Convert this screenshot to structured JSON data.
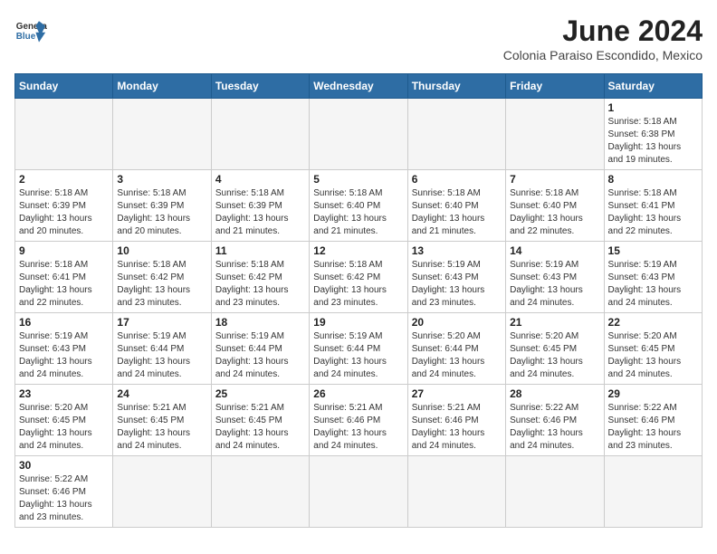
{
  "header": {
    "logo_general": "General",
    "logo_blue": "Blue",
    "month_title": "June 2024",
    "subtitle": "Colonia Paraiso Escondido, Mexico"
  },
  "weekdays": [
    "Sunday",
    "Monday",
    "Tuesday",
    "Wednesday",
    "Thursday",
    "Friday",
    "Saturday"
  ],
  "days": {
    "d1": {
      "num": "1",
      "sunrise": "Sunrise: 5:18 AM",
      "sunset": "Sunset: 6:38 PM",
      "daylight": "Daylight: 13 hours and 19 minutes."
    },
    "d2": {
      "num": "2",
      "sunrise": "Sunrise: 5:18 AM",
      "sunset": "Sunset: 6:39 PM",
      "daylight": "Daylight: 13 hours and 20 minutes."
    },
    "d3": {
      "num": "3",
      "sunrise": "Sunrise: 5:18 AM",
      "sunset": "Sunset: 6:39 PM",
      "daylight": "Daylight: 13 hours and 20 minutes."
    },
    "d4": {
      "num": "4",
      "sunrise": "Sunrise: 5:18 AM",
      "sunset": "Sunset: 6:39 PM",
      "daylight": "Daylight: 13 hours and 21 minutes."
    },
    "d5": {
      "num": "5",
      "sunrise": "Sunrise: 5:18 AM",
      "sunset": "Sunset: 6:40 PM",
      "daylight": "Daylight: 13 hours and 21 minutes."
    },
    "d6": {
      "num": "6",
      "sunrise": "Sunrise: 5:18 AM",
      "sunset": "Sunset: 6:40 PM",
      "daylight": "Daylight: 13 hours and 21 minutes."
    },
    "d7": {
      "num": "7",
      "sunrise": "Sunrise: 5:18 AM",
      "sunset": "Sunset: 6:40 PM",
      "daylight": "Daylight: 13 hours and 22 minutes."
    },
    "d8": {
      "num": "8",
      "sunrise": "Sunrise: 5:18 AM",
      "sunset": "Sunset: 6:41 PM",
      "daylight": "Daylight: 13 hours and 22 minutes."
    },
    "d9": {
      "num": "9",
      "sunrise": "Sunrise: 5:18 AM",
      "sunset": "Sunset: 6:41 PM",
      "daylight": "Daylight: 13 hours and 22 minutes."
    },
    "d10": {
      "num": "10",
      "sunrise": "Sunrise: 5:18 AM",
      "sunset": "Sunset: 6:42 PM",
      "daylight": "Daylight: 13 hours and 23 minutes."
    },
    "d11": {
      "num": "11",
      "sunrise": "Sunrise: 5:18 AM",
      "sunset": "Sunset: 6:42 PM",
      "daylight": "Daylight: 13 hours and 23 minutes."
    },
    "d12": {
      "num": "12",
      "sunrise": "Sunrise: 5:18 AM",
      "sunset": "Sunset: 6:42 PM",
      "daylight": "Daylight: 13 hours and 23 minutes."
    },
    "d13": {
      "num": "13",
      "sunrise": "Sunrise: 5:19 AM",
      "sunset": "Sunset: 6:43 PM",
      "daylight": "Daylight: 13 hours and 23 minutes."
    },
    "d14": {
      "num": "14",
      "sunrise": "Sunrise: 5:19 AM",
      "sunset": "Sunset: 6:43 PM",
      "daylight": "Daylight: 13 hours and 24 minutes."
    },
    "d15": {
      "num": "15",
      "sunrise": "Sunrise: 5:19 AM",
      "sunset": "Sunset: 6:43 PM",
      "daylight": "Daylight: 13 hours and 24 minutes."
    },
    "d16": {
      "num": "16",
      "sunrise": "Sunrise: 5:19 AM",
      "sunset": "Sunset: 6:43 PM",
      "daylight": "Daylight: 13 hours and 24 minutes."
    },
    "d17": {
      "num": "17",
      "sunrise": "Sunrise: 5:19 AM",
      "sunset": "Sunset: 6:44 PM",
      "daylight": "Daylight: 13 hours and 24 minutes."
    },
    "d18": {
      "num": "18",
      "sunrise": "Sunrise: 5:19 AM",
      "sunset": "Sunset: 6:44 PM",
      "daylight": "Daylight: 13 hours and 24 minutes."
    },
    "d19": {
      "num": "19",
      "sunrise": "Sunrise: 5:19 AM",
      "sunset": "Sunset: 6:44 PM",
      "daylight": "Daylight: 13 hours and 24 minutes."
    },
    "d20": {
      "num": "20",
      "sunrise": "Sunrise: 5:20 AM",
      "sunset": "Sunset: 6:44 PM",
      "daylight": "Daylight: 13 hours and 24 minutes."
    },
    "d21": {
      "num": "21",
      "sunrise": "Sunrise: 5:20 AM",
      "sunset": "Sunset: 6:45 PM",
      "daylight": "Daylight: 13 hours and 24 minutes."
    },
    "d22": {
      "num": "22",
      "sunrise": "Sunrise: 5:20 AM",
      "sunset": "Sunset: 6:45 PM",
      "daylight": "Daylight: 13 hours and 24 minutes."
    },
    "d23": {
      "num": "23",
      "sunrise": "Sunrise: 5:20 AM",
      "sunset": "Sunset: 6:45 PM",
      "daylight": "Daylight: 13 hours and 24 minutes."
    },
    "d24": {
      "num": "24",
      "sunrise": "Sunrise: 5:21 AM",
      "sunset": "Sunset: 6:45 PM",
      "daylight": "Daylight: 13 hours and 24 minutes."
    },
    "d25": {
      "num": "25",
      "sunrise": "Sunrise: 5:21 AM",
      "sunset": "Sunset: 6:45 PM",
      "daylight": "Daylight: 13 hours and 24 minutes."
    },
    "d26": {
      "num": "26",
      "sunrise": "Sunrise: 5:21 AM",
      "sunset": "Sunset: 6:46 PM",
      "daylight": "Daylight: 13 hours and 24 minutes."
    },
    "d27": {
      "num": "27",
      "sunrise": "Sunrise: 5:21 AM",
      "sunset": "Sunset: 6:46 PM",
      "daylight": "Daylight: 13 hours and 24 minutes."
    },
    "d28": {
      "num": "28",
      "sunrise": "Sunrise: 5:22 AM",
      "sunset": "Sunset: 6:46 PM",
      "daylight": "Daylight: 13 hours and 24 minutes."
    },
    "d29": {
      "num": "29",
      "sunrise": "Sunrise: 5:22 AM",
      "sunset": "Sunset: 6:46 PM",
      "daylight": "Daylight: 13 hours and 23 minutes."
    },
    "d30": {
      "num": "30",
      "sunrise": "Sunrise: 5:22 AM",
      "sunset": "Sunset: 6:46 PM",
      "daylight": "Daylight: 13 hours and 23 minutes."
    }
  }
}
